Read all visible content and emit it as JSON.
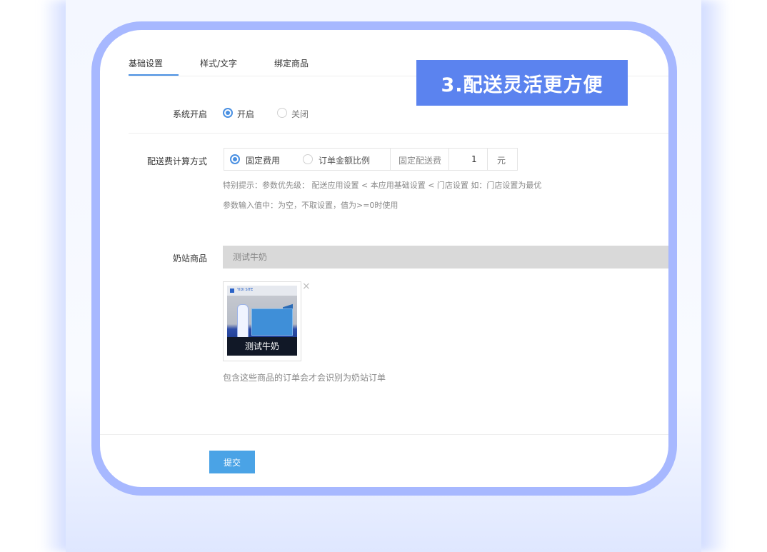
{
  "banner": {
    "text": "3.配送灵活更方便"
  },
  "tabs": [
    {
      "label": "基础设置",
      "active": true
    },
    {
      "label": "样式/文字",
      "active": false
    },
    {
      "label": "绑定商品",
      "active": false
    }
  ],
  "system_toggle": {
    "label": "系统开启",
    "options": [
      {
        "label": "开启",
        "selected": true
      },
      {
        "label": "关闭",
        "selected": false
      }
    ]
  },
  "delivery_fee": {
    "label": "配送费计算方式",
    "options": [
      {
        "label": "固定费用",
        "selected": true
      },
      {
        "label": "订单金额比例",
        "selected": false
      }
    ],
    "amount_label": "固定配送费",
    "amount_value": "1",
    "unit": "元",
    "hints": [
      "特别提示：参数优先级： 配送应用设置 < 本应用基础设置 < 门店设置 如：门店设置为最优",
      "参数输入值中：为空，不取设置，值为>=0时使用"
    ]
  },
  "milk_products": {
    "label": "奶站商品",
    "input_value": "测试牛奶",
    "items": [
      {
        "name": "测试牛奶",
        "brand_strip": "YIDI SITE"
      }
    ],
    "remove_glyph": "×",
    "note": "包含这些商品的订单会才会识别为奶站订单"
  },
  "submit": {
    "label": "提交"
  },
  "colors": {
    "accent": "#4a90e2",
    "banner": "#5b83ef",
    "card_border": "#a7b8ff",
    "submit": "#4aa3e6"
  }
}
